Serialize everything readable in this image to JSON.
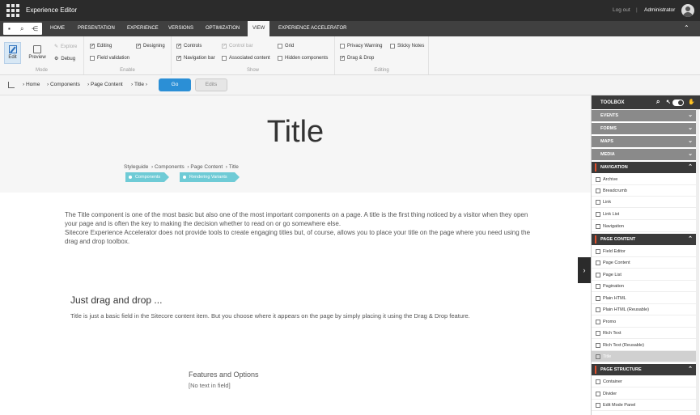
{
  "header": {
    "app_title": "Experience Editor",
    "logout": "Log out",
    "separator": "|",
    "user": "Administrator"
  },
  "tabs": [
    {
      "label": "HOME"
    },
    {
      "label": "PRESENTATION"
    },
    {
      "label": "EXPERIENCE"
    },
    {
      "label": "VERSIONS"
    },
    {
      "label": "OPTIMIZATION"
    },
    {
      "label": "VIEW",
      "active": true
    },
    {
      "label": "EXPERIENCE ACCELERATOR"
    }
  ],
  "ribbon": {
    "mode": {
      "label": "Mode",
      "edit": "Edit",
      "preview": "Preview",
      "explore": "Explore",
      "debug": "Debug"
    },
    "enable": {
      "label": "Enable",
      "editing": {
        "label": "Editing",
        "checked": true
      },
      "designing": {
        "label": "Designing",
        "checked": true
      },
      "field_validation": {
        "label": "Field validation",
        "checked": false
      }
    },
    "show": {
      "label": "Show",
      "controls": {
        "label": "Controls",
        "checked": true
      },
      "control_bar": {
        "label": "Control bar",
        "checked": true,
        "disabled": true
      },
      "grid": {
        "label": "Grid",
        "checked": false
      },
      "navigation_bar": {
        "label": "Navigation bar",
        "checked": true
      },
      "associated_content": {
        "label": "Associated content",
        "checked": false
      },
      "hidden_components": {
        "label": "Hidden components",
        "checked": false
      }
    },
    "editing": {
      "label": "Editing",
      "privacy_warning": {
        "label": "Privacy Warning",
        "checked": false
      },
      "sticky_notes": {
        "label": "Sticky Notes",
        "checked": false
      },
      "drag_drop": {
        "label": "Drag & Drop",
        "checked": true
      }
    }
  },
  "breadcrumb": {
    "items": [
      "Home",
      "Components",
      "Page Content",
      "Title"
    ],
    "go": "Go",
    "edits": "Edits"
  },
  "page": {
    "title": "Title",
    "styleguide_crumb": [
      "Styleguide",
      "Components",
      "Page Content",
      "Title"
    ],
    "tags": [
      "Components",
      "Rendering Variants"
    ],
    "intro1": "The Title component is one of the most basic but also one of the most important components on a page. A title is the first thing noticed by a visitor when they open your page and is often the key to making the decision whether to read on or go somewhere else.",
    "intro2": "Sitecore Experience Accelerator does not provide tools to create engaging titles but, of course, allows you to place your title on the page where you need using the drag and drop toolbox.",
    "h2": "Just drag and drop ...",
    "p2": "Title is just a basic field in the Sitecore content item. But you choose where it appears on the page by simply placing it using the Drag & Drop feature.",
    "h3": "Features and Options",
    "p3": "[No text in field]"
  },
  "toolbox": {
    "title": "TOOLBOX",
    "collapsed_sections": [
      "EVENTS",
      "FORMS",
      "MAPS",
      "MEDIA"
    ],
    "navigation": {
      "label": "NAVIGATION",
      "items": [
        "Archive",
        "Breadcrumb",
        "Link",
        "Link List",
        "Navigation"
      ]
    },
    "page_content": {
      "label": "PAGE CONTENT",
      "items": [
        "Field Editor",
        "Page Content",
        "Page List",
        "Pagination",
        "Plain HTML",
        "Plain HTML (Reusable)",
        "Promo",
        "Rich Text",
        "Rich Text (Reusable)",
        "Title"
      ],
      "selected": "Title"
    },
    "page_structure": {
      "label": "PAGE STRUCTURE",
      "items": [
        "Container",
        "Divider",
        "Edit Mode Panel"
      ]
    }
  },
  "colors": {
    "topbar": "#2b2b2b",
    "accent_blue": "#2b8fd6",
    "tag_teal": "#6fcbd6",
    "section_marker": "#e04f2c"
  }
}
